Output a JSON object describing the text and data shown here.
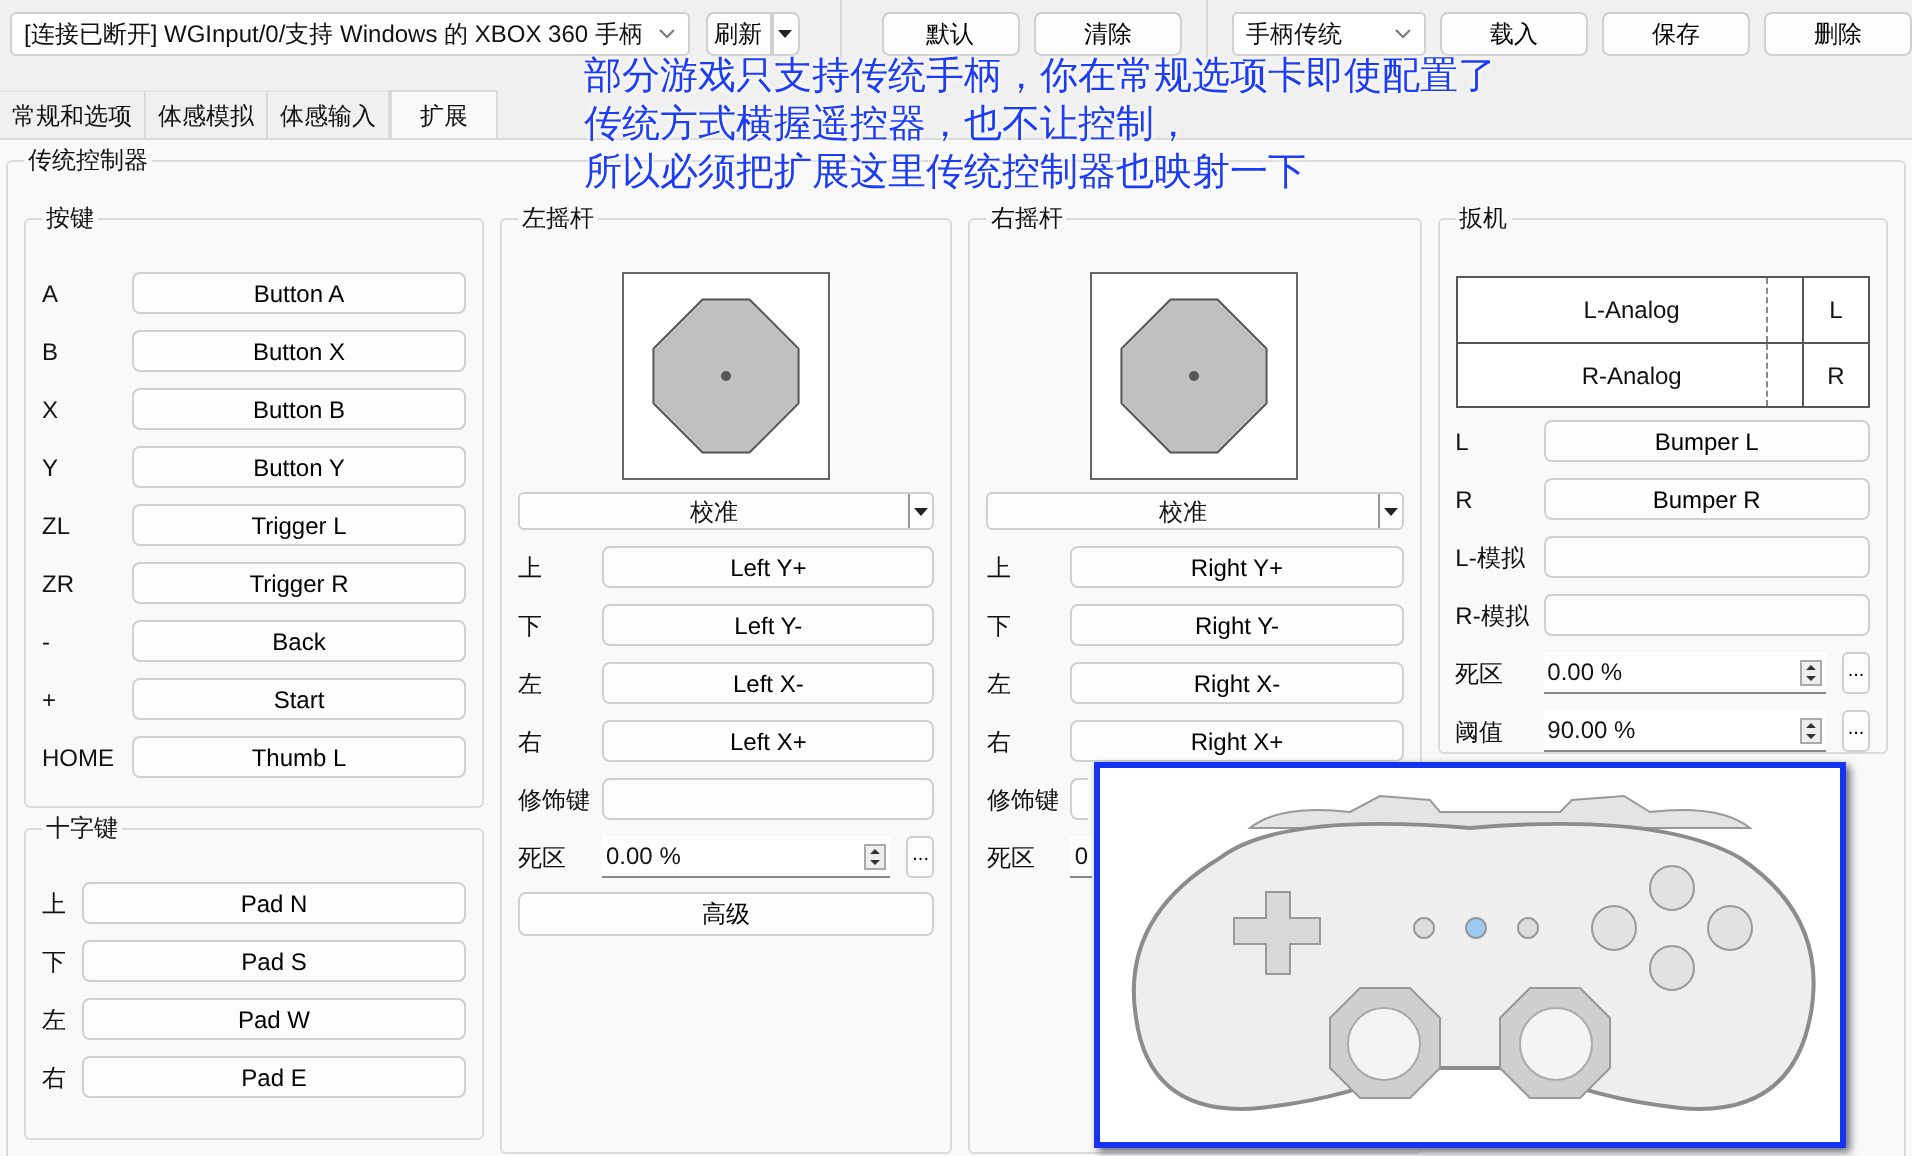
{
  "toolbar": {
    "device_select": "[连接已断开] WGInput/0/支持 Windows 的 XBOX 360 手柄",
    "refresh": "刷新",
    "buttons": [
      "默认",
      "清除"
    ],
    "profile_select": "手柄传统",
    "profile_buttons": [
      "载入",
      "保存",
      "删除"
    ]
  },
  "tabs": [
    {
      "label": "常规和选项",
      "selected": false
    },
    {
      "label": "体感模拟",
      "selected": false
    },
    {
      "label": "体感输入",
      "selected": false
    },
    {
      "label": "扩展",
      "selected": true
    }
  ],
  "annotation": [
    "部分游戏只支持传统手柄，你在常规选项卡即使配置了",
    "传统方式横握遥控器，也不让控制，",
    "所以必须把扩展这里传统控制器也映射一下"
  ],
  "group_title": "传统控制器",
  "buttons_group": {
    "title": "按键",
    "rows": [
      {
        "label": "A",
        "value": "Button A"
      },
      {
        "label": "B",
        "value": "Button X"
      },
      {
        "label": "X",
        "value": "Button B"
      },
      {
        "label": "Y",
        "value": "Button Y"
      },
      {
        "label": "ZL",
        "value": "Trigger L"
      },
      {
        "label": "ZR",
        "value": "Trigger R"
      },
      {
        "label": "-",
        "value": "Back"
      },
      {
        "label": "+",
        "value": "Start"
      },
      {
        "label": "HOME",
        "value": "Thumb L"
      }
    ]
  },
  "dpad": {
    "title": "十字键",
    "rows": [
      {
        "label": "上",
        "value": "Pad N"
      },
      {
        "label": "下",
        "value": "Pad S"
      },
      {
        "label": "左",
        "value": "Pad W"
      },
      {
        "label": "右",
        "value": "Pad E"
      }
    ]
  },
  "sticks": [
    {
      "title": "左摇杆",
      "calibrate": "校准",
      "rows": [
        {
          "label": "上",
          "value": "Left Y+"
        },
        {
          "label": "下",
          "value": "Left Y-"
        },
        {
          "label": "左",
          "value": "Left X-"
        },
        {
          "label": "右",
          "value": "Left X+"
        }
      ],
      "modifier_label": "修饰键",
      "deadzone_label": "死区",
      "deadzone": "0.00 %",
      "more": "...",
      "advanced": "高级"
    },
    {
      "title": "右摇杆",
      "calibrate": "校准",
      "rows": [
        {
          "label": "上",
          "value": "Right Y+"
        },
        {
          "label": "下",
          "value": "Right Y-"
        },
        {
          "label": "左",
          "value": "Right X-"
        },
        {
          "label": "右",
          "value": "Right X+"
        }
      ],
      "modifier_label": "修饰键",
      "deadzone_label": "死区",
      "deadzone": "0"
    }
  ],
  "triggers": {
    "title": "扳机",
    "table": [
      {
        "name": "L-Analog",
        "key": "L"
      },
      {
        "name": "R-Analog",
        "key": "R"
      }
    ],
    "rows": [
      {
        "label": "L",
        "value": "Bumper L"
      },
      {
        "label": "R",
        "value": "Bumper R"
      },
      {
        "label": "L-模拟"
      },
      {
        "label": "R-模拟"
      }
    ],
    "spins": [
      {
        "label": "死区",
        "value": "0.00 %",
        "more": "..."
      },
      {
        "label": "阈值",
        "value": "90.00 %",
        "more": "..."
      }
    ]
  },
  "image": {
    "kind": "picture"
  }
}
